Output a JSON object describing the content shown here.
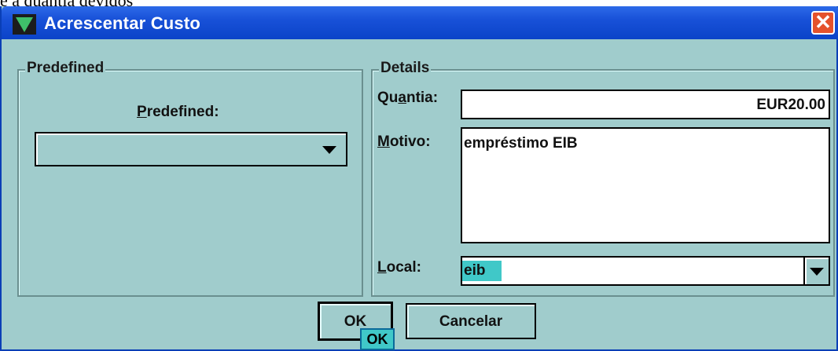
{
  "page": {
    "above_text": "e a quantia devidos"
  },
  "window": {
    "title": "Acrescentar Custo",
    "close_symbol": "✕"
  },
  "predefined_group": {
    "title": "Predefined",
    "label_pre": "",
    "label_mnemonic": "P",
    "label_rest": "redefined:",
    "select_value": ""
  },
  "details_group": {
    "title": "Details",
    "quantia": {
      "label_pre": "Qu",
      "label_mnemonic": "a",
      "label_rest": "ntia:",
      "value": "EUR20.00"
    },
    "motivo": {
      "label_pre": "",
      "label_mnemonic": "M",
      "label_rest": "otivo:",
      "value": "empréstimo EIB"
    },
    "local": {
      "label_pre": "",
      "label_mnemonic": "L",
      "label_rest": "ocal:",
      "value": "eib"
    }
  },
  "buttons": {
    "ok": "OK",
    "cancel": "Cancelar",
    "tooltip": "OK"
  },
  "colors": {
    "window_bg": "#a0cccc",
    "titlebar": "#1851d8",
    "selection": "#40c8c8"
  }
}
